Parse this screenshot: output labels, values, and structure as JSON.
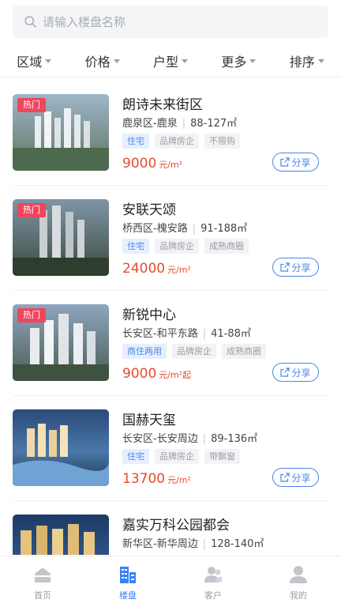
{
  "search": {
    "placeholder": "请输入楼盘名称"
  },
  "filters": [
    {
      "label": "区域"
    },
    {
      "label": "价格"
    },
    {
      "label": "户型"
    },
    {
      "label": "更多"
    },
    {
      "label": "排序"
    }
  ],
  "listings": [
    {
      "badge": "热门",
      "name": "朗诗未来街区",
      "district": "鹿泉区-鹿泉",
      "area": "88-127㎡",
      "tags": [
        "住宅",
        "品牌房企",
        "不限购"
      ],
      "price": "9000",
      "unit": "元/m²",
      "share": "分享"
    },
    {
      "badge": "热门",
      "name": "安联天颂",
      "district": "桥西区-槐安路",
      "area": "91-188㎡",
      "tags": [
        "住宅",
        "品牌房企",
        "成熟商圈"
      ],
      "price": "24000",
      "unit": "元/m²",
      "share": "分享"
    },
    {
      "badge": "热门",
      "name": "新锐中心",
      "district": "长安区-和平东路",
      "area": "41-88㎡",
      "tags": [
        "商住两用",
        "品牌房企",
        "成熟商圈"
      ],
      "price": "9000",
      "unit": "元/m²起",
      "share": "分享"
    },
    {
      "badge": "",
      "name": "国赫天玺",
      "district": "长安区-长安周边",
      "area": "89-136㎡",
      "tags": [
        "住宅",
        "品牌房企",
        "带飘窗"
      ],
      "price": "13700",
      "unit": "元/m²",
      "share": "分享"
    },
    {
      "badge": "",
      "name": "嘉实万科公园都会",
      "district": "新华区-新华周边",
      "area": "128-140㎡",
      "tags": [],
      "price": "",
      "unit": "",
      "share": ""
    }
  ],
  "tabbar": [
    {
      "label": "首页",
      "icon": "home-icon"
    },
    {
      "label": "楼盘",
      "icon": "building-icon"
    },
    {
      "label": "客户",
      "icon": "customers-icon"
    },
    {
      "label": "我的",
      "icon": "profile-icon"
    }
  ],
  "colors": {
    "accent": "#4a86e8",
    "price": "#e84b2f",
    "hot_badge": "#f0455c"
  }
}
